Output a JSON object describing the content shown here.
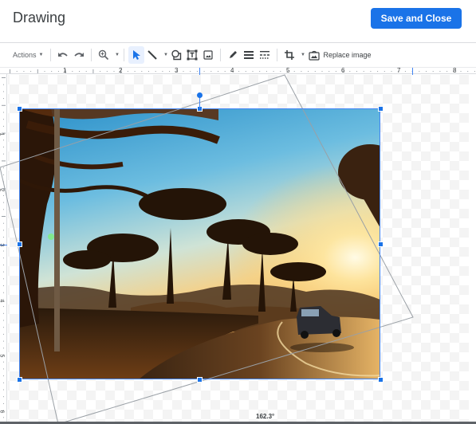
{
  "header": {
    "title": "Drawing",
    "save_button": "Save and Close"
  },
  "toolbar": {
    "actions_label": "Actions",
    "replace_image_label": "Replace image",
    "items": [
      {
        "name": "undo-icon"
      },
      {
        "name": "redo-icon"
      },
      {
        "name": "zoom-icon"
      },
      {
        "name": "select-icon",
        "active": true
      },
      {
        "name": "line-icon"
      },
      {
        "name": "shape-icon"
      },
      {
        "name": "text-box-icon"
      },
      {
        "name": "image-icon"
      },
      {
        "name": "pen-icon"
      },
      {
        "name": "line-weight-icon"
      },
      {
        "name": "line-dash-icon"
      },
      {
        "name": "crop-icon"
      },
      {
        "name": "replace-image-icon"
      }
    ]
  },
  "ruler": {
    "horizontal_labels": [
      "1",
      "2",
      "3",
      "4",
      "5",
      "6",
      "7",
      "8"
    ],
    "vertical_labels": [
      "1",
      "2",
      "3",
      "4",
      "5",
      "6"
    ]
  },
  "canvas": {
    "rotation_angle": "162.3°",
    "image_description": "Sunset road with silhouetted trees and a car"
  },
  "colors": {
    "accent": "#1a73e8",
    "selection": "#4285f4"
  }
}
